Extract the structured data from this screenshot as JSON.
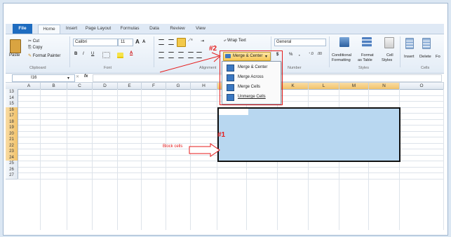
{
  "tabs": [
    "File",
    "Home",
    "Insert",
    "Page Layout",
    "Formulas",
    "Data",
    "Review",
    "View"
  ],
  "clipboard": {
    "paste": "Paste",
    "cut": "Cut",
    "copy": "Copy",
    "format_painter": "Format Painter",
    "group": "Clipboard"
  },
  "font": {
    "name": "Calibri",
    "size": "11",
    "bold": "B",
    "italic": "I",
    "underline": "U",
    "grow": "A",
    "shrink": "A",
    "group": "Font"
  },
  "alignment": {
    "wrap_text": "Wrap Text",
    "merge_center": "Merge & Center",
    "group": "Alignment"
  },
  "number": {
    "format": "General",
    "dollar": "$",
    "percent": "%",
    "comma": ",",
    "group": "Number"
  },
  "styles": {
    "conditional": "Conditional",
    "conditional2": "Formatting",
    "format_as": "Format",
    "format_as2": "as Table",
    "cell": "Cell",
    "cell2": "Styles",
    "group": "Styles"
  },
  "cells": {
    "insert": "Insert",
    "delete": "Delete",
    "format": "Fo",
    "group": "Cells"
  },
  "formula_bar": {
    "name_box": "I16",
    "fx": "fx"
  },
  "columns": [
    "A",
    "B",
    "C",
    "D",
    "E",
    "F",
    "G",
    "H",
    "I",
    "J",
    "K",
    "L",
    "M",
    "N",
    "O"
  ],
  "selected_columns": [
    "I",
    "J",
    "K",
    "L",
    "M",
    "N"
  ],
  "rows": [
    "13",
    "14",
    "15",
    "16",
    "17",
    "18",
    "19",
    "20",
    "21",
    "22",
    "23",
    "24",
    "25",
    "26",
    "27"
  ],
  "selected_rows": [
    "16",
    "17",
    "18",
    "19",
    "20",
    "21",
    "22",
    "23",
    "24"
  ],
  "merge_menu": {
    "items": [
      "Merge & Center",
      "Merge Across",
      "Merge Cells",
      "Unmerge Cells"
    ]
  },
  "annotations": {
    "one": "#1",
    "two": "#2",
    "block_label": "Block cells"
  },
  "colors": {
    "selection": "#b8d7f0",
    "accent": "#e51b1b",
    "file_tab": "#1e6cc0"
  }
}
